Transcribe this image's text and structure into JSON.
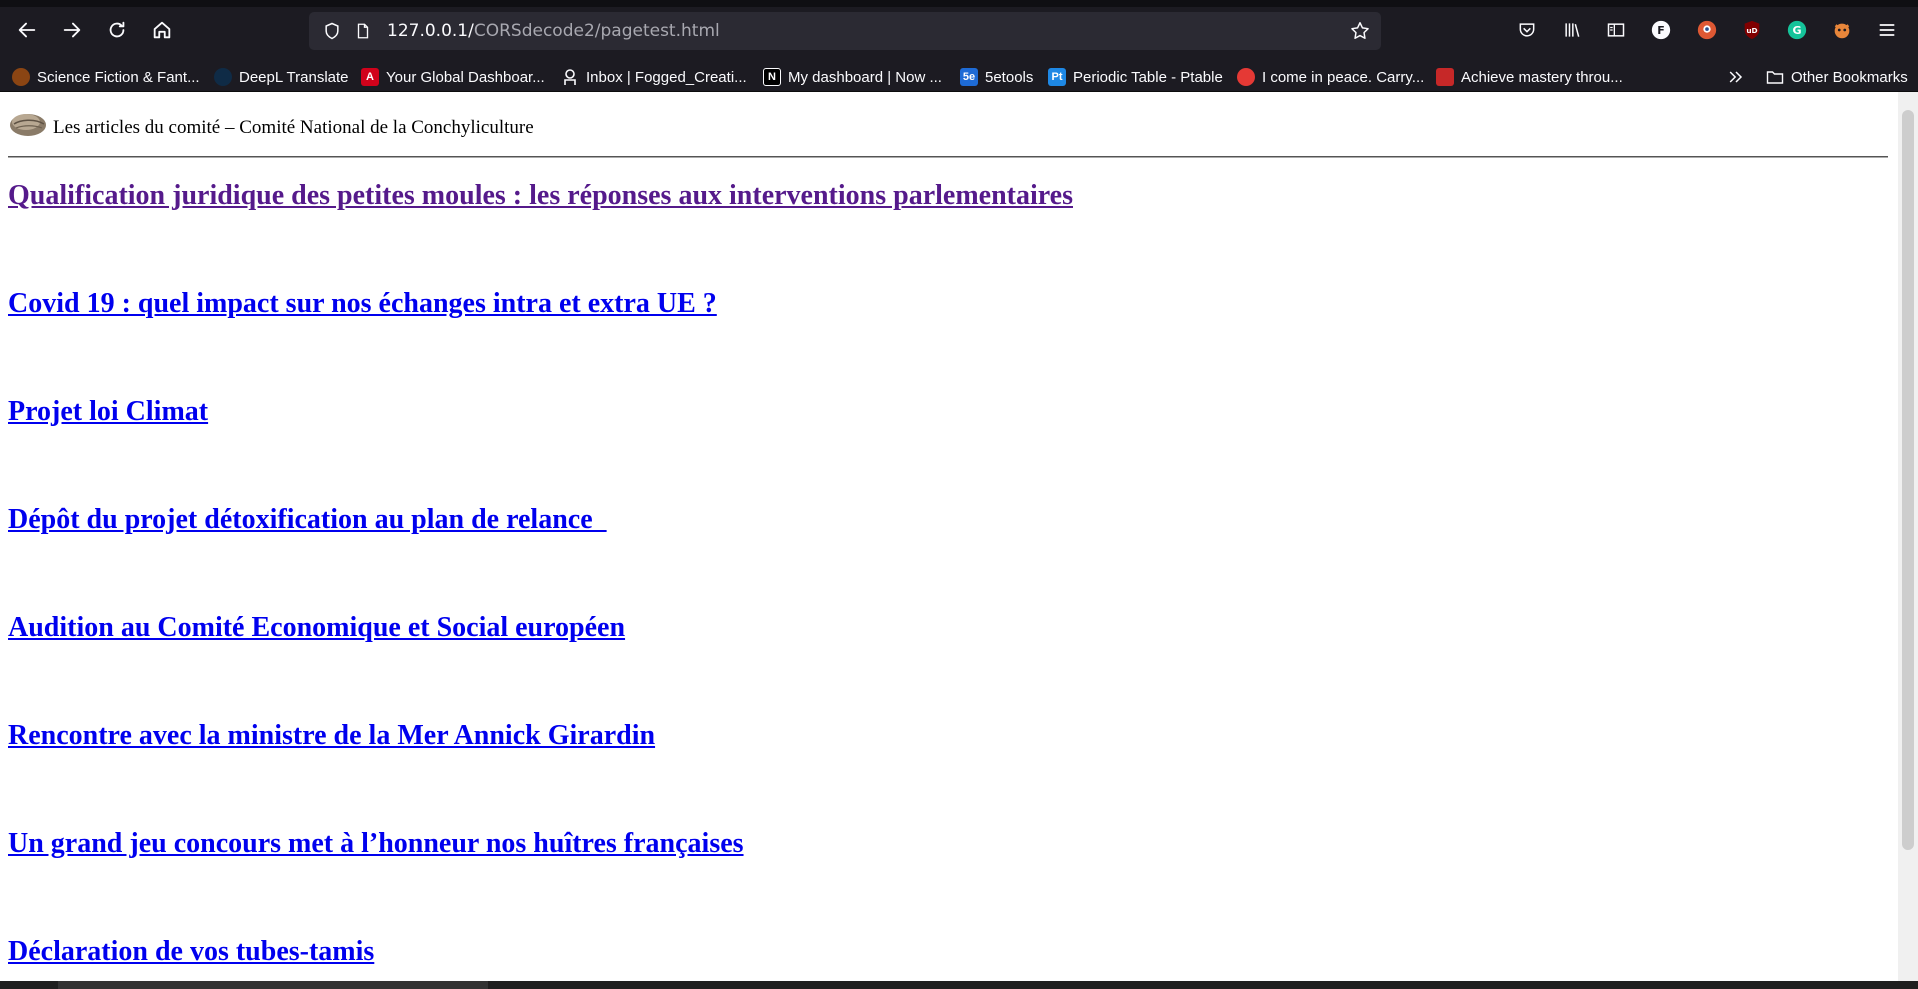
{
  "browser": {
    "url_host": "127.0.0.1/",
    "url_path": "CORSdecode2/pagetest.html",
    "bookmarks": [
      {
        "label": "Science Fiction & Fant...",
        "icon": "book-favicon",
        "color": "#8b4513"
      },
      {
        "label": "DeepL Translate",
        "icon": "deepl-favicon",
        "color": "#0f2b46"
      },
      {
        "label": "Your Global Dashboar...",
        "icon": "a-favicon",
        "color": "#d0021b"
      },
      {
        "label": "Inbox | Fogged_Creati...",
        "icon": "proton-favicon",
        "color": "#6d4aff"
      },
      {
        "label": "My dashboard | Now ...",
        "icon": "notion-favicon",
        "color": "#000000"
      },
      {
        "label": "5etools",
        "icon": "5etools-favicon",
        "color": "#1e6bd6"
      },
      {
        "label": "Periodic Table - Ptable",
        "icon": "ptable-favicon",
        "color": "#1e88e5"
      },
      {
        "label": "I come in peace. Carry...",
        "icon": "red-circle-favicon",
        "color": "#e53935"
      },
      {
        "label": "Achieve mastery throu...",
        "icon": "mastery-favicon",
        "color": "#c62828"
      }
    ],
    "other_bookmarks": "Other Bookmarks"
  },
  "page": {
    "header_text": "Les articles du comité – Comité National de la Conchyliculture",
    "articles": [
      {
        "title": "Qualification juridique des petites moules : les réponses aux interventions parlementaires",
        "visited": true
      },
      {
        "title": "Covid 19 : quel impact sur nos échanges intra et extra UE ?",
        "visited": false
      },
      {
        "title": "Projet loi Climat",
        "visited": false
      },
      {
        "title": "Dépôt du projet détoxification au plan de relance  ",
        "visited": false
      },
      {
        "title": "Audition au Comité Economique et Social européen",
        "visited": false
      },
      {
        "title": "Rencontre avec la ministre de la Mer Annick Girardin",
        "visited": false
      },
      {
        "title": "Un grand jeu concours met à l’honneur nos huîtres françaises",
        "visited": false
      },
      {
        "title": "Déclaration de vos tubes-tamis",
        "visited": false
      }
    ]
  },
  "colors": {
    "link": "#0000ee",
    "visited_link": "#551a8b",
    "chrome_bg": "#1c1b22",
    "urlbar_bg": "#2b2a33"
  }
}
